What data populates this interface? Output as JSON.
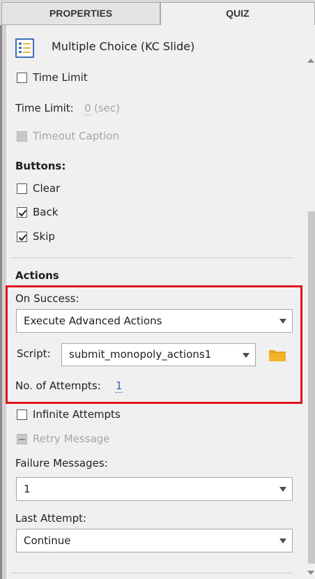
{
  "tabs": [
    {
      "label": "PROPERTIES"
    },
    {
      "label": "QUIZ"
    }
  ],
  "slide": {
    "title": "Multiple Choice (KC Slide)",
    "icon": "question-slide-icon"
  },
  "time_limit": {
    "checkbox_label": "Time Limit",
    "checked": false,
    "field_label": "Time Limit:",
    "value": "0",
    "unit": "(sec)"
  },
  "timeout_caption": {
    "label": "Timeout Caption",
    "enabled": false
  },
  "buttons_section": {
    "title": "Buttons:",
    "items": [
      {
        "label": "Clear",
        "checked": false
      },
      {
        "label": "Back",
        "checked": true
      },
      {
        "label": "Skip",
        "checked": true
      }
    ]
  },
  "actions": {
    "title": "Actions",
    "on_success_label": "On Success:",
    "on_success_value": "Execute Advanced Actions",
    "script_label": "Script:",
    "script_value": "submit_monopoly_actions1",
    "attempts_label": "No. of Attempts:",
    "attempts_value": "1",
    "infinite_attempts_label": "Infinite Attempts",
    "retry_message_label": "Retry Message",
    "failure_messages_label": "Failure Messages:",
    "failure_messages_value": "1",
    "last_attempt_label": "Last Attempt:",
    "last_attempt_value": "Continue"
  },
  "colors": {
    "highlight": "#e1141e",
    "folder": "#e8a317",
    "link": "#2a63b6"
  }
}
